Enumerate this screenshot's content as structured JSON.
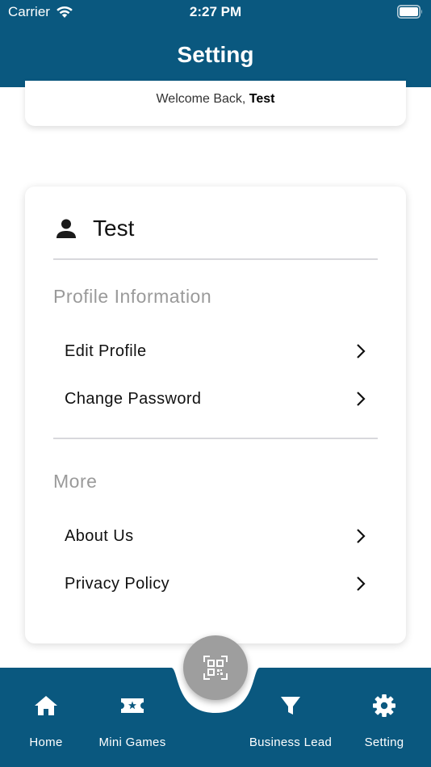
{
  "status_bar": {
    "carrier": "Carrier",
    "time": "2:27 PM"
  },
  "header": {
    "title": "Setting"
  },
  "welcome": {
    "prefix": "Welcome Back, ",
    "name": "Test"
  },
  "profile": {
    "username": "Test",
    "sections": [
      {
        "title": "Profile Information",
        "items": [
          {
            "label": "Edit Profile"
          },
          {
            "label": "Change Password"
          }
        ]
      },
      {
        "title": "More",
        "items": [
          {
            "label": "About Us"
          },
          {
            "label": "Privacy Policy"
          }
        ]
      }
    ]
  },
  "bottom_nav": {
    "items": [
      {
        "label": "Home",
        "icon": "home-icon"
      },
      {
        "label": "Mini Games",
        "icon": "ticket-icon"
      },
      {
        "label": "Business Lead",
        "icon": "filter-icon"
      },
      {
        "label": "Setting",
        "icon": "gear-icon"
      }
    ],
    "center_button_icon": "qr-code-icon"
  },
  "colors": {
    "primary": "#0a587f",
    "fab": "#9e9e9e",
    "section_title": "#9a9a9a",
    "divider": "#d8d8dc"
  }
}
